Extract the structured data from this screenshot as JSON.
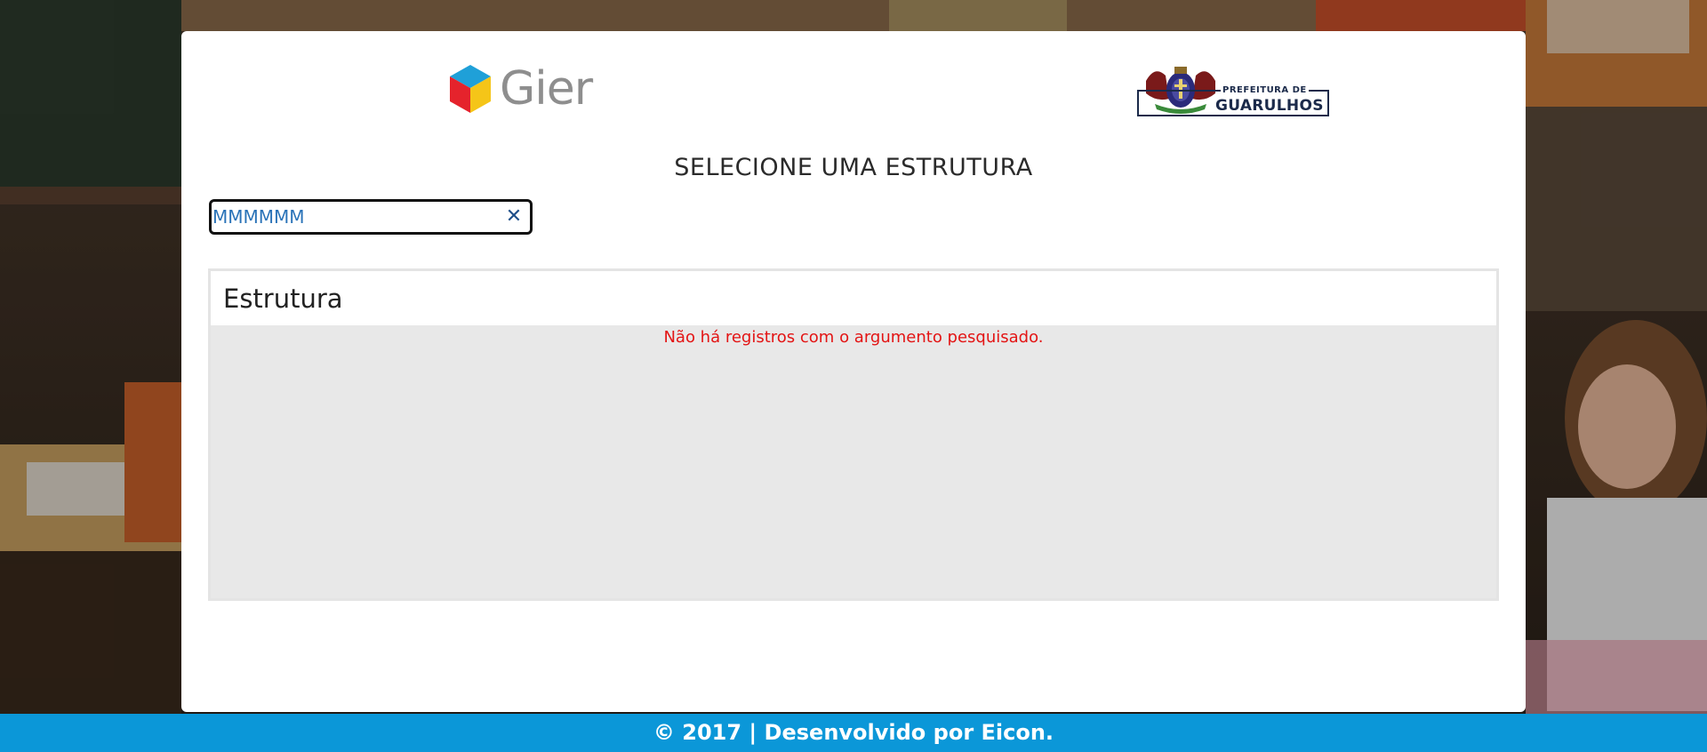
{
  "logos": {
    "gier_text": "Gier",
    "guarulhos_small": "PREFEITURA DE",
    "guarulhos_big": "GUARULHOS"
  },
  "page": {
    "title": "SELECIONE UMA ESTRUTURA"
  },
  "search": {
    "value": "MMMMMM",
    "clear_symbol": "✕"
  },
  "table": {
    "header": "Estrutura",
    "empty_message": "Não há registros com o argumento pesquisado."
  },
  "footer": {
    "text": "© 2017 | Desenvolvido por Eicon."
  },
  "colors": {
    "footer_bg": "#0b97d8",
    "error_text": "#e31414",
    "search_text": "#2a73b8"
  }
}
